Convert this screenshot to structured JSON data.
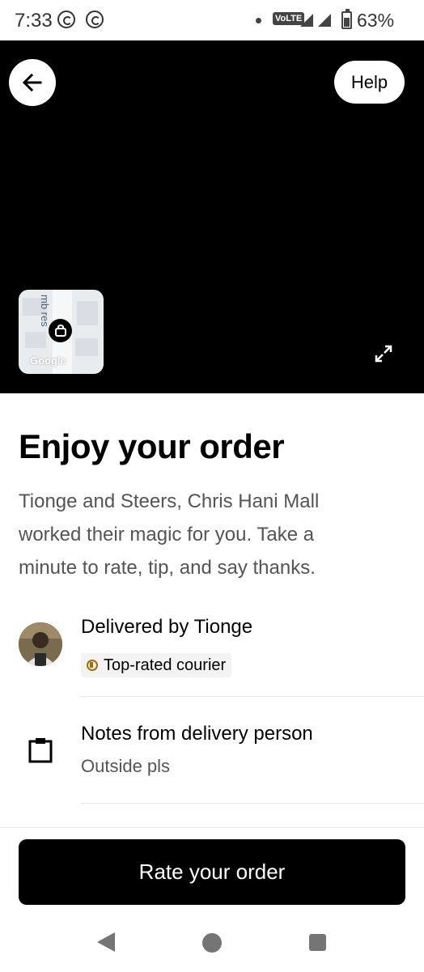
{
  "status_bar": {
    "time": "7:33",
    "volte": "VoLTE",
    "battery_percent": "63%",
    "battery_level": 0.63,
    "icons": [
      "whatsapp-icon",
      "whatsapp-business-icon",
      "notification-dot-icon",
      "signal-icon",
      "battery-icon"
    ]
  },
  "map": {
    "help_label": "Help",
    "street_fragment": "mb  res",
    "attribution": "Google",
    "background_color": "#000000"
  },
  "main": {
    "title": "Enjoy your order",
    "description": "Tionge and Steers, Chris Hani Mall worked their magic for you. Take a minute to rate, tip, and say thanks."
  },
  "courier": {
    "delivered_by": "Delivered by Tionge",
    "badge": "Top-rated courier",
    "badge_color": "#a86a06"
  },
  "notes": {
    "title": "Notes from delivery person",
    "body": "Outside pls"
  },
  "footer": {
    "rate_button_label": "Rate your order"
  },
  "nav_bar": {
    "icons": [
      "back-nav-icon",
      "home-nav-icon",
      "recents-nav-icon"
    ]
  }
}
